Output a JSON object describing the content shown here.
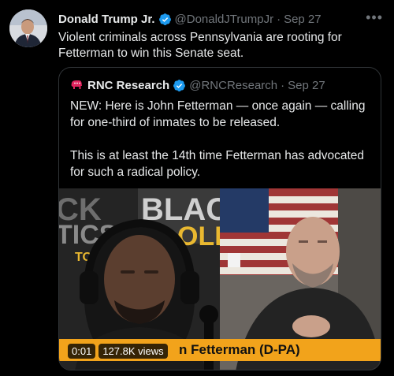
{
  "tweet": {
    "author_name": "Donald Trump Jr.",
    "handle": "@DonaldJTrumpJr",
    "separator": "·",
    "date": "Sep 27",
    "text": "Violent criminals across Pennsylvania are rooting for Fetterman to win this Senate seat."
  },
  "quoted": {
    "author_name": "RNC Research",
    "handle": "@RNCResearch",
    "separator": "·",
    "date": "Sep 27",
    "paragraph1": "NEW: Here is John Fetterman — once again — calling for one-third of inmates to be released.",
    "paragraph2": "This is at least the 14th time Fetterman has advocated for such a radical policy."
  },
  "video": {
    "time": "0:01",
    "views": "127.8K views",
    "lower_third": "n Fetterman (D-PA)",
    "bg_text_left": "CK  BLAC  TICS  POLI  TOD",
    "bg_text_right": ""
  },
  "colors": {
    "background": "#000000",
    "text": "#e7e9ea",
    "muted": "#71767b",
    "verified": "#1d9bf0",
    "border": "#2f3336",
    "rnc_red": "#e0245e",
    "lower_third": "#f2a31b"
  },
  "icons": [
    "verified-badge-icon",
    "more-options-icon",
    "rnc-elephant-icon"
  ]
}
